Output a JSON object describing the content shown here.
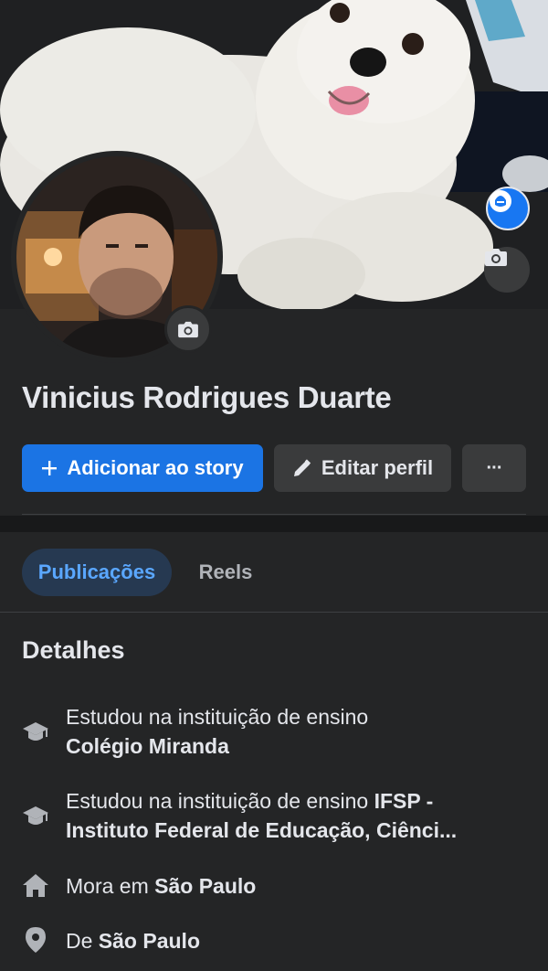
{
  "profile": {
    "name": "Vinicius Rodrigues Duarte"
  },
  "actions": {
    "add_story": "Adicionar ao story",
    "edit_profile": "Editar perfil",
    "more": "···"
  },
  "tabs": [
    {
      "label": "Publicações",
      "active": true
    },
    {
      "label": "Reels",
      "active": false
    }
  ],
  "details": {
    "title": "Detalhes",
    "items": [
      {
        "icon": "graduation-cap-icon",
        "prefix": "Estudou na instituição de ensino",
        "value": "Colégio Miranda"
      },
      {
        "icon": "graduation-cap-icon",
        "prefix": "Estudou na instituição de ensino",
        "value_part1": "IFSP -",
        "value_part2": "Instituto Federal de Educação, Ciênci..."
      },
      {
        "icon": "home-icon",
        "prefix": "Mora em",
        "value": "São Paulo"
      },
      {
        "icon": "location-pin-icon",
        "prefix": "De",
        "value": "São Paulo"
      }
    ]
  },
  "colors": {
    "background": "#242526",
    "primary_button": "#1b74e4",
    "secondary_button": "#3a3b3c",
    "active_tab_bg": "#263951",
    "active_tab_text": "#5aa7ff"
  }
}
